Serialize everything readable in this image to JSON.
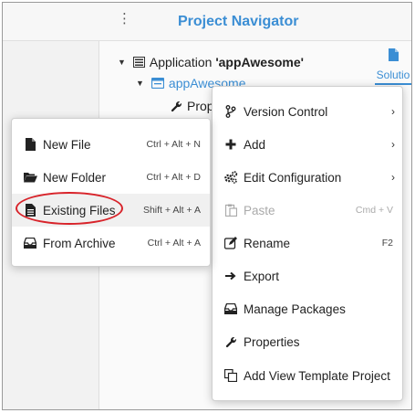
{
  "panel": {
    "title": "Project Navigator",
    "solution_tab_label": "Solutio"
  },
  "tree": {
    "app_prefix": "Application ",
    "app_name": "'appAwesome'",
    "project": "appAwesome",
    "child": "Prop"
  },
  "context_menu": {
    "items": [
      {
        "label": "Version Control",
        "shortcut": "",
        "icon": "branch-icon"
      },
      {
        "label": "Add",
        "shortcut": "",
        "icon": "plus-icon"
      },
      {
        "label": "Edit Configuration",
        "shortcut": "",
        "icon": "cogs-icon"
      },
      {
        "label": "Paste",
        "shortcut": "Cmd + V",
        "icon": "paste-icon"
      },
      {
        "label": "Rename",
        "shortcut": "F2",
        "icon": "rename-icon"
      },
      {
        "label": "Export",
        "shortcut": "",
        "icon": "export-icon"
      },
      {
        "label": "Manage Packages",
        "shortcut": "",
        "icon": "package-icon"
      },
      {
        "label": "Properties",
        "shortcut": "",
        "icon": "wrench-icon"
      },
      {
        "label": "Add View Template Project",
        "shortcut": "",
        "icon": "copy-icon"
      }
    ]
  },
  "submenu": {
    "items": [
      {
        "label": "New File",
        "shortcut": "Ctrl + Alt + N",
        "icon": "file-icon"
      },
      {
        "label": "New Folder",
        "shortcut": "Ctrl + Alt + D",
        "icon": "folder-open-icon"
      },
      {
        "label": "Existing Files",
        "shortcut": "Shift + Alt + A",
        "icon": "file-text-icon"
      },
      {
        "label": "From Archive",
        "shortcut": "Ctrl + Alt + A",
        "icon": "inbox-icon"
      }
    ]
  },
  "colors": {
    "accent": "#3b8ed4",
    "highlight_circle": "#d8232a"
  }
}
